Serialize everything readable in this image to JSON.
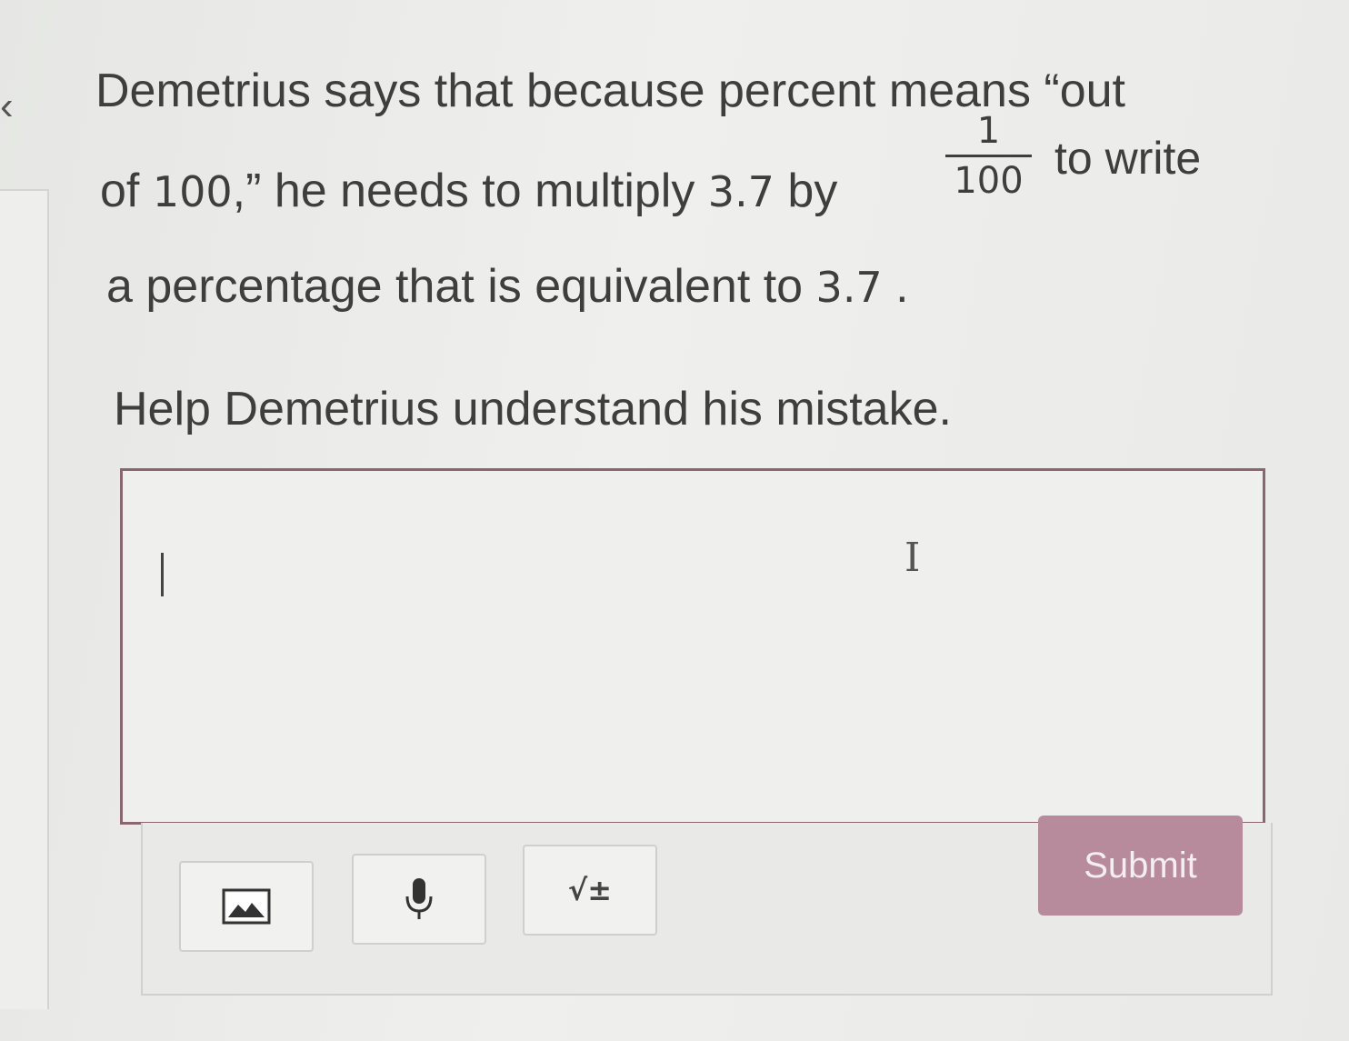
{
  "question": {
    "line1": "Demetrius says that because percent means “out",
    "line2_a": "of ",
    "line2_num": "100",
    "line2_b": ",” he needs to multiply ",
    "line2_val": "3.7",
    "line2_c": " by",
    "fraction_numerator": "1",
    "fraction_denominator": "100",
    "line2_end": "to write",
    "line3_a": "a percentage that is equivalent to ",
    "line3_val": "3.7",
    "line3_b": " .",
    "prompt": "Help Demetrius understand his mistake."
  },
  "answer": {
    "value": "",
    "placeholder": ""
  },
  "toolbar": {
    "image_icon": "image-icon",
    "mic_icon": "microphone-icon",
    "math_label": "√±",
    "submit_label": "Submit"
  },
  "colors": {
    "accent_border": "#8a6673",
    "submit_bg": "#b78b9b"
  }
}
